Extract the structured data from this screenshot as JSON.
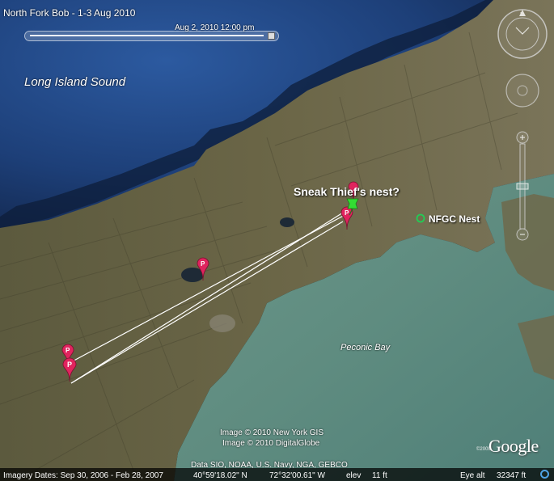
{
  "document": {
    "title": "North Fork Bob - 1-3 Aug 2010"
  },
  "time_slider": {
    "label": "Aug  2, 2010  12:00 pm",
    "position": 0.98
  },
  "map": {
    "water_labels": {
      "sound": "Long Island Sound",
      "bay": "Peconic Bay"
    },
    "placemarks": {
      "sneak_thief_nest": "Sneak Thief's nest?",
      "nfgc_nest": "NFGC Nest"
    },
    "credits": [
      "Image © 2010 New York GIS",
      "Image © 2010 DigitalGlobe",
      "Data SIO, NOAA, U.S. Navy, NGA, GEBCO"
    ]
  },
  "status_bar": {
    "imagery_dates": "Imagery Dates: Sep 30, 2006 - Feb 28, 2007",
    "latitude": "40°59'18.02\" N",
    "longitude": "72°32'00.61\" W",
    "elevation_label": "elev",
    "elevation_value": "11 ft",
    "eye_alt_label": "Eye alt",
    "eye_alt_value": "32347 ft"
  },
  "branding": {
    "logo": "Google",
    "copyright": "©2009"
  },
  "colors": {
    "sound_water": "#1d3f78",
    "bay_water": "#5f8c80",
    "land": "#6b6647",
    "track_line": "#ffffff",
    "pin_red": "#e0245e",
    "pin_green": "#33dd33",
    "nest_ring": "#22cc55"
  },
  "icons": [
    "compass-icon",
    "look-joystick-icon",
    "move-joystick-icon",
    "zoom-slider-icon",
    "pushpin-icon",
    "placemark-pin-icon",
    "circle-placemark-icon",
    "globe-status-icon"
  ]
}
